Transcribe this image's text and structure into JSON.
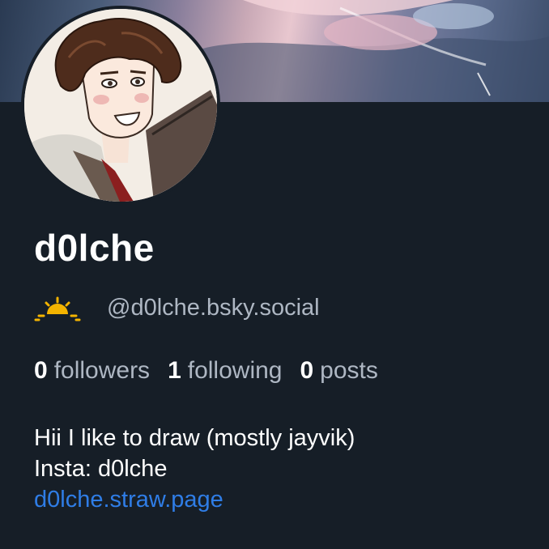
{
  "profile": {
    "display_name": "d0lche",
    "handle": "@d0lche.bsky.social",
    "banner": "banner-image",
    "avatar": "avatar-portrait-image",
    "handle_icon": "sun-icon",
    "handle_icon_color": "#f4b400"
  },
  "stats": [
    {
      "count": "0",
      "label": "followers"
    },
    {
      "count": "1",
      "label": "following"
    },
    {
      "count": "0",
      "label": "posts"
    }
  ],
  "bio": {
    "line1": "Hii I like to draw (mostly jayvik)",
    "line2": "Insta: d0lche",
    "link": "d0lche.straw.page",
    "link_color": "#2f7de6"
  },
  "colors": {
    "background": "#161e27",
    "name": "#ffffff",
    "muted": "#aeb7c3"
  }
}
